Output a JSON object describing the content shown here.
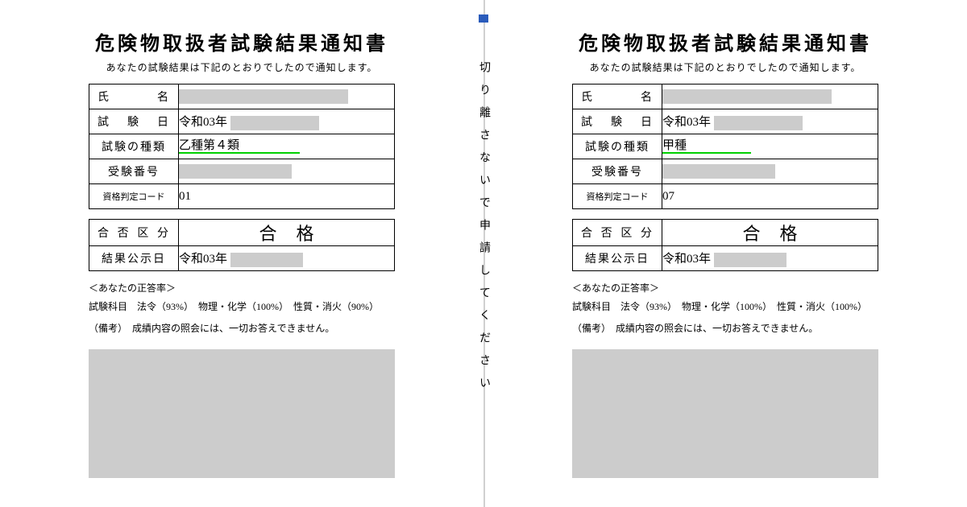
{
  "divider_text": "切り離さないで申請してください",
  "left": {
    "title": "危険物取扱者試験結果通知書",
    "subtitle": "あなたの試験結果は下記のとおりでしたので通知します。",
    "rows": {
      "name_label": "氏名",
      "date_label": "試験日",
      "date_value": "令和03年",
      "type_label": "試験の種類",
      "type_value": "乙種第４類",
      "number_label": "受験番号",
      "code_label": "資格判定コード",
      "code_value": "01",
      "result_label": "合否区分",
      "result_value": "合格",
      "pubdate_label": "結果公示日",
      "pubdate_value": "令和03年"
    },
    "score_header": "＜あなたの正答率＞",
    "score_line": "試験科目　法令（93%）　物理・化学（100%）　性質・消火（90%）",
    "note": "（備考）　成績内容の照会には、一切お答えできません。"
  },
  "right": {
    "title": "危険物取扱者試験結果通知書",
    "subtitle": "あなたの試験結果は下記のとおりでしたので通知します。",
    "rows": {
      "name_label": "氏名",
      "date_label": "試験日",
      "date_value": "令和03年",
      "type_label": "試験の種類",
      "type_value": "甲種",
      "number_label": "受験番号",
      "code_label": "資格判定コード",
      "code_value": "07",
      "result_label": "合否区分",
      "result_value": "合格",
      "pubdate_label": "結果公示日",
      "pubdate_value": "令和03年"
    },
    "score_header": "＜あなたの正答率＞",
    "score_line": "試験科目　法令（93%）　物理・化学（100%）　性質・消火（100%）",
    "note": "（備考）　成績内容の照会には、一切お答えできません。"
  }
}
